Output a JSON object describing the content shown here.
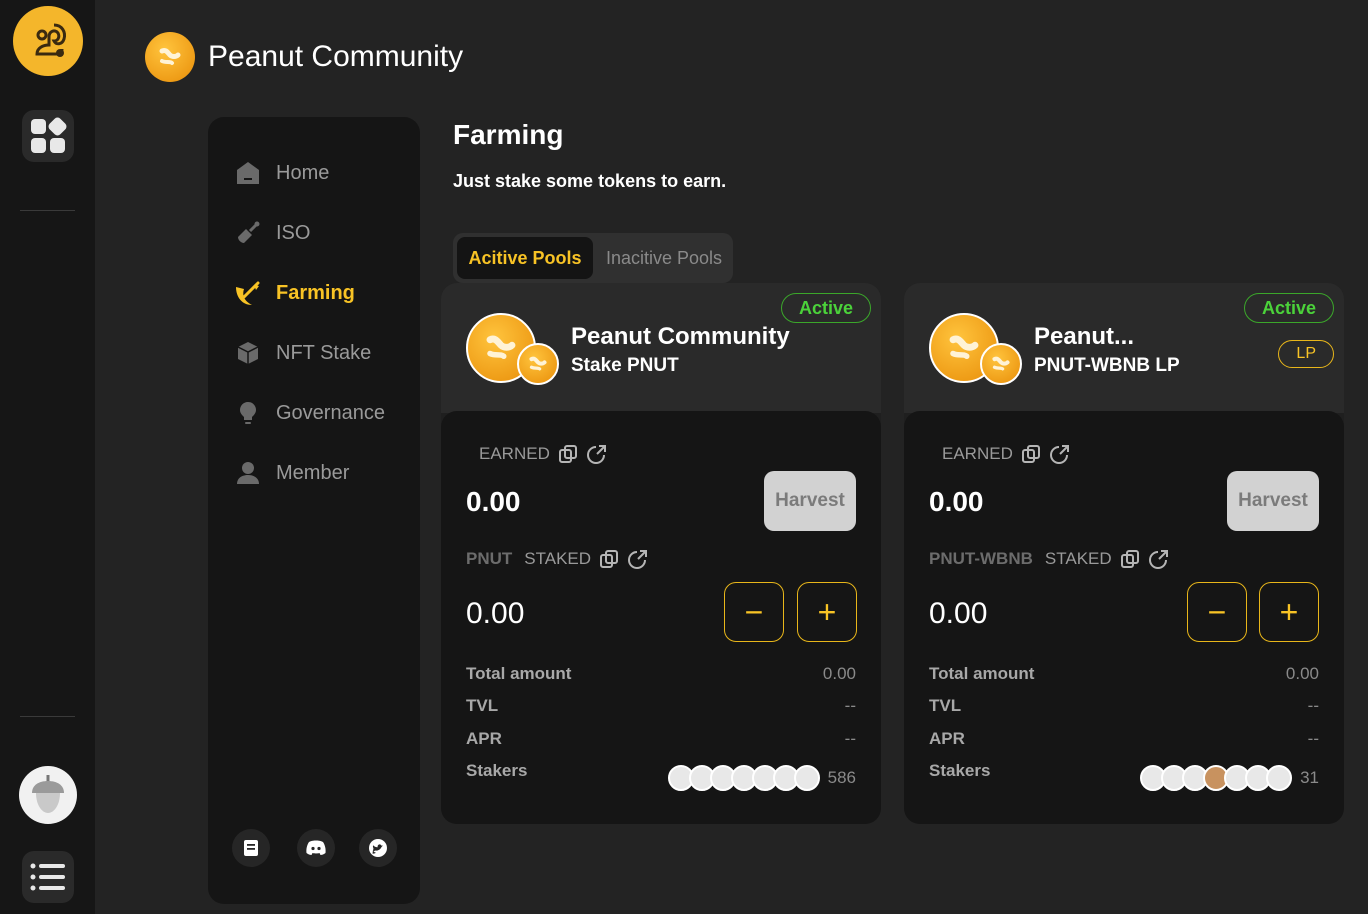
{
  "app": {
    "title": "Peanut Community"
  },
  "nav": {
    "items": [
      {
        "label": "Home",
        "icon": "home-icon",
        "active": false
      },
      {
        "label": "ISO",
        "icon": "shovel-icon",
        "active": false
      },
      {
        "label": "Farming",
        "icon": "farming-icon",
        "active": true
      },
      {
        "label": "NFT Stake",
        "icon": "cube-icon",
        "active": false
      },
      {
        "label": "Governance",
        "icon": "bulb-icon",
        "active": false
      },
      {
        "label": "Member",
        "icon": "user-icon",
        "active": false
      }
    ],
    "social": [
      "docs-icon",
      "discord-icon",
      "twitter-icon"
    ]
  },
  "main": {
    "title": "Farming",
    "subtitle": "Just stake some tokens to earn.",
    "tabs": [
      {
        "label": "Acitive Pools",
        "active": true
      },
      {
        "label": "Inacitive Pools",
        "active": false
      }
    ]
  },
  "pools": [
    {
      "status": "Active",
      "lp_badge": "",
      "name": "Peanut Community",
      "sub": "Stake PNUT",
      "earned_label": "EARNED",
      "earned_value": "0.00",
      "harvest_label": "Harvest",
      "staked_token": "PNUT",
      "staked_label": "STAKED",
      "staked_value": "0.00",
      "minus": "−",
      "plus": "+",
      "rows": [
        {
          "label": "Total amount",
          "value": "0.00"
        },
        {
          "label": "TVL",
          "value": "--"
        },
        {
          "label": "APR",
          "value": "--"
        },
        {
          "label": "Stakers",
          "value": ""
        }
      ],
      "stakers_count": "586"
    },
    {
      "status": "Active",
      "lp_badge": "LP",
      "name": "Peanut...",
      "sub": "PNUT-WBNB LP",
      "earned_label": "EARNED",
      "earned_value": "0.00",
      "harvest_label": "Harvest",
      "staked_token": "PNUT-WBNB",
      "staked_label": "STAKED",
      "staked_value": "0.00",
      "minus": "−",
      "plus": "+",
      "rows": [
        {
          "label": "Total amount",
          "value": "0.00"
        },
        {
          "label": "TVL",
          "value": "--"
        },
        {
          "label": "APR",
          "value": "--"
        },
        {
          "label": "Stakers",
          "value": ""
        }
      ],
      "stakers_count": "31"
    }
  ],
  "colors": {
    "accent": "#f8c325",
    "active_green": "#4bd23a",
    "background": "#232323"
  }
}
